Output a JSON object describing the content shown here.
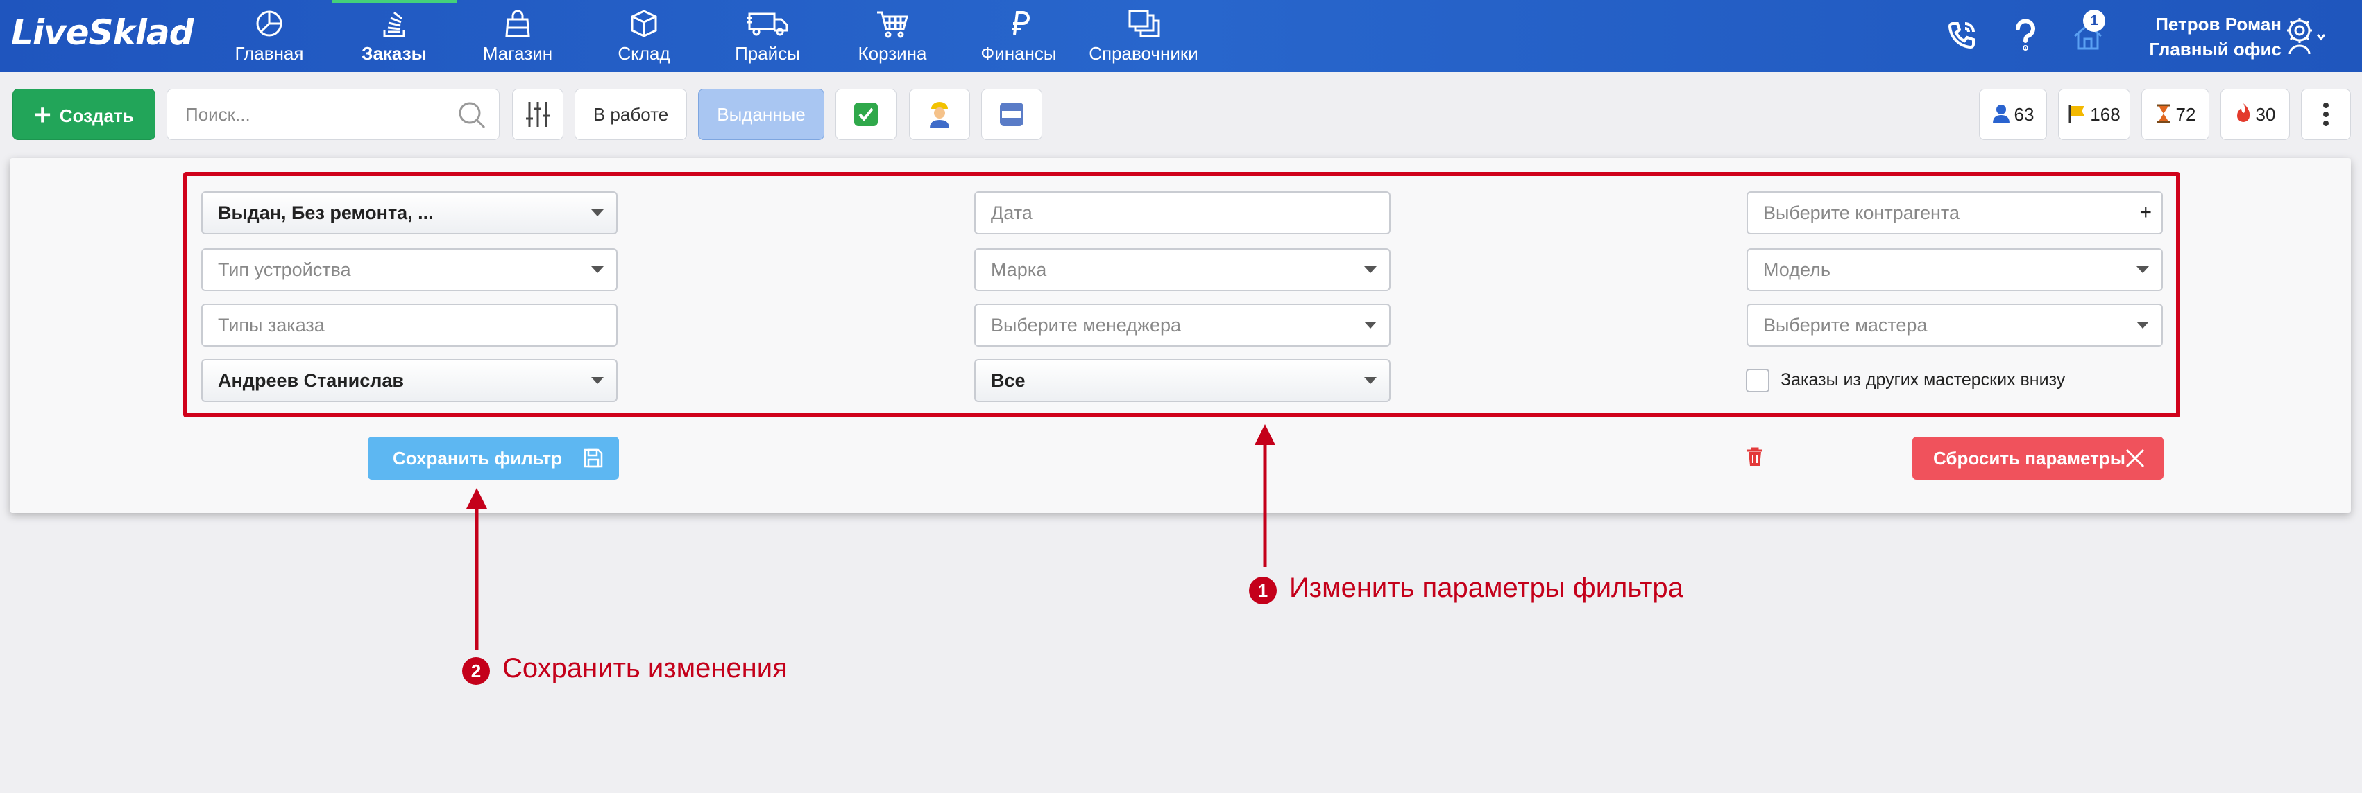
{
  "app": {
    "logo": "LiveSklad"
  },
  "nav": {
    "items": [
      {
        "label": "Главная",
        "icon": "dashboard-icon"
      },
      {
        "label": "Заказы",
        "icon": "orders-icon",
        "active": true
      },
      {
        "label": "Магазин",
        "icon": "shop-bag-icon"
      },
      {
        "label": "Склад",
        "icon": "box-icon"
      },
      {
        "label": "Прайсы",
        "icon": "truck-icon"
      },
      {
        "label": "Корзина",
        "icon": "cart-icon"
      },
      {
        "label": "Финансы",
        "icon": "ruble-icon"
      },
      {
        "label": "Справочники",
        "icon": "copy-icon"
      }
    ],
    "notifications_count": "1",
    "user_name": "Петров Роман",
    "user_office": "Главный офис",
    "accent": "#44d17a"
  },
  "toolbar": {
    "create_label": "Создать",
    "search_placeholder": "Поиск...",
    "tab_in_work": "В работе",
    "tab_issued": "Выданные",
    "counters": [
      {
        "value": "63",
        "icon": "user-icon",
        "color": "#2a63cf"
      },
      {
        "value": "168",
        "icon": "flag-icon",
        "color": "#f3b800"
      },
      {
        "value": "72",
        "icon": "hourglass-icon",
        "color": "#e0661e"
      },
      {
        "value": "30",
        "icon": "fire-icon",
        "color": "#e33a2c"
      }
    ]
  },
  "filter": {
    "status_value": "Выдан, Без ремонта, ...",
    "date_placeholder": "Дата",
    "client_placeholder": "Выберите контрагента",
    "device_type_placeholder": "Тип устройства",
    "brand_placeholder": "Марка",
    "model_placeholder": "Модель",
    "order_types_placeholder": "Типы заказа",
    "manager_placeholder": "Выберите менеджера",
    "master_placeholder": "Выберите мастера",
    "employee_value": "Андреев Станислав",
    "scope_value": "Все",
    "other_workshops_label": "Заказы из других мастерских внизу",
    "save_label": "Сохранить фильтр",
    "reset_label": "Сбросить параметры"
  },
  "annotations": {
    "step1_number": "1",
    "step1_text": "Изменить параметры фильтра",
    "step2_number": "2",
    "step2_text": "Сохранить изменения",
    "color": "#c4001a"
  }
}
